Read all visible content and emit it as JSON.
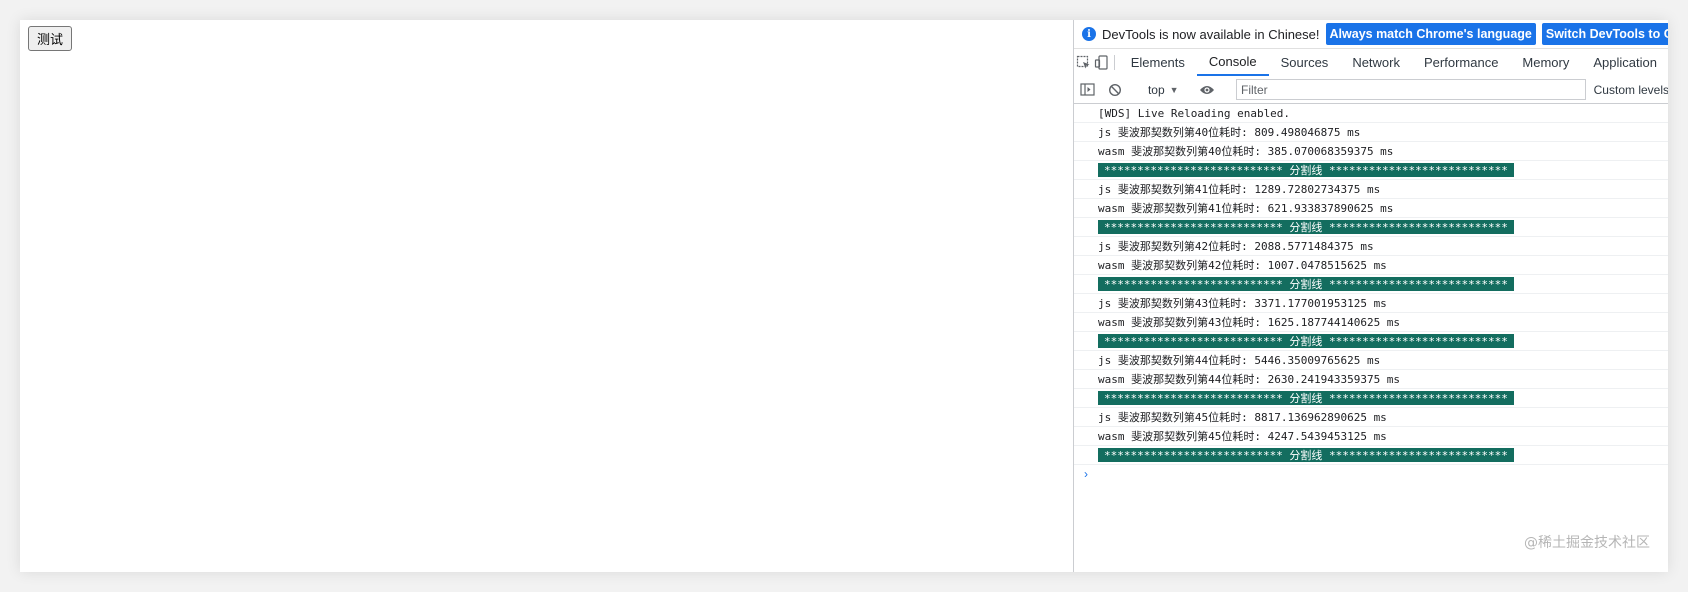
{
  "page": {
    "button_label": "测试"
  },
  "devtools": {
    "infobar": {
      "message": "DevTools is now available in Chinese!",
      "match_button": "Always match Chrome's language",
      "switch_button": "Switch DevTools to Chinese"
    },
    "tabs": [
      "Elements",
      "Console",
      "Sources",
      "Network",
      "Performance",
      "Memory",
      "Application"
    ],
    "active_tab": "Console",
    "filterbar": {
      "context": "top",
      "filter_placeholder": "Filter",
      "levels_label": "Custom levels"
    },
    "console_messages": [
      {
        "type": "log",
        "text": "[WDS] Live Reloading enabled."
      },
      {
        "type": "log",
        "text": "js 斐波那契数列第40位耗时: 809.498046875 ms"
      },
      {
        "type": "log",
        "text": "wasm 斐波那契数列第40位耗时: 385.070068359375 ms"
      },
      {
        "type": "separator",
        "text": "*************************** 分割线 ***************************"
      },
      {
        "type": "log",
        "text": "js 斐波那契数列第41位耗时: 1289.72802734375 ms"
      },
      {
        "type": "log",
        "text": "wasm 斐波那契数列第41位耗时: 621.933837890625 ms"
      },
      {
        "type": "separator",
        "text": "*************************** 分割线 ***************************"
      },
      {
        "type": "log",
        "text": "js 斐波那契数列第42位耗时: 2088.5771484375 ms"
      },
      {
        "type": "log",
        "text": "wasm 斐波那契数列第42位耗时: 1007.0478515625 ms"
      },
      {
        "type": "separator",
        "text": "*************************** 分割线 ***************************"
      },
      {
        "type": "log",
        "text": "js 斐波那契数列第43位耗时: 3371.177001953125 ms"
      },
      {
        "type": "log",
        "text": "wasm 斐波那契数列第43位耗时: 1625.187744140625 ms"
      },
      {
        "type": "separator",
        "text": "*************************** 分割线 ***************************"
      },
      {
        "type": "log",
        "text": "js 斐波那契数列第44位耗时: 5446.35009765625 ms"
      },
      {
        "type": "log",
        "text": "wasm 斐波那契数列第44位耗时: 2630.241943359375 ms"
      },
      {
        "type": "separator",
        "text": "*************************** 分割线 ***************************"
      },
      {
        "type": "log",
        "text": "js 斐波那契数列第45位耗时: 8817.136962890625 ms"
      },
      {
        "type": "log",
        "text": "wasm 斐波那契数列第45位耗时: 4247.5439453125 ms"
      },
      {
        "type": "separator",
        "text": "*************************** 分割线 ***************************"
      }
    ],
    "prompt_symbol": "›"
  },
  "watermark": "@稀土掘金技术社区",
  "colors": {
    "accent": "#1a73e8",
    "separator_bg": "#136d5f",
    "separator_text": "#ffffff"
  },
  "icons": [
    "info-icon",
    "inspect-element-icon",
    "device-toolbar-icon",
    "sidebar-toggle-icon",
    "clear-console-icon",
    "live-expression-eye-icon"
  ]
}
